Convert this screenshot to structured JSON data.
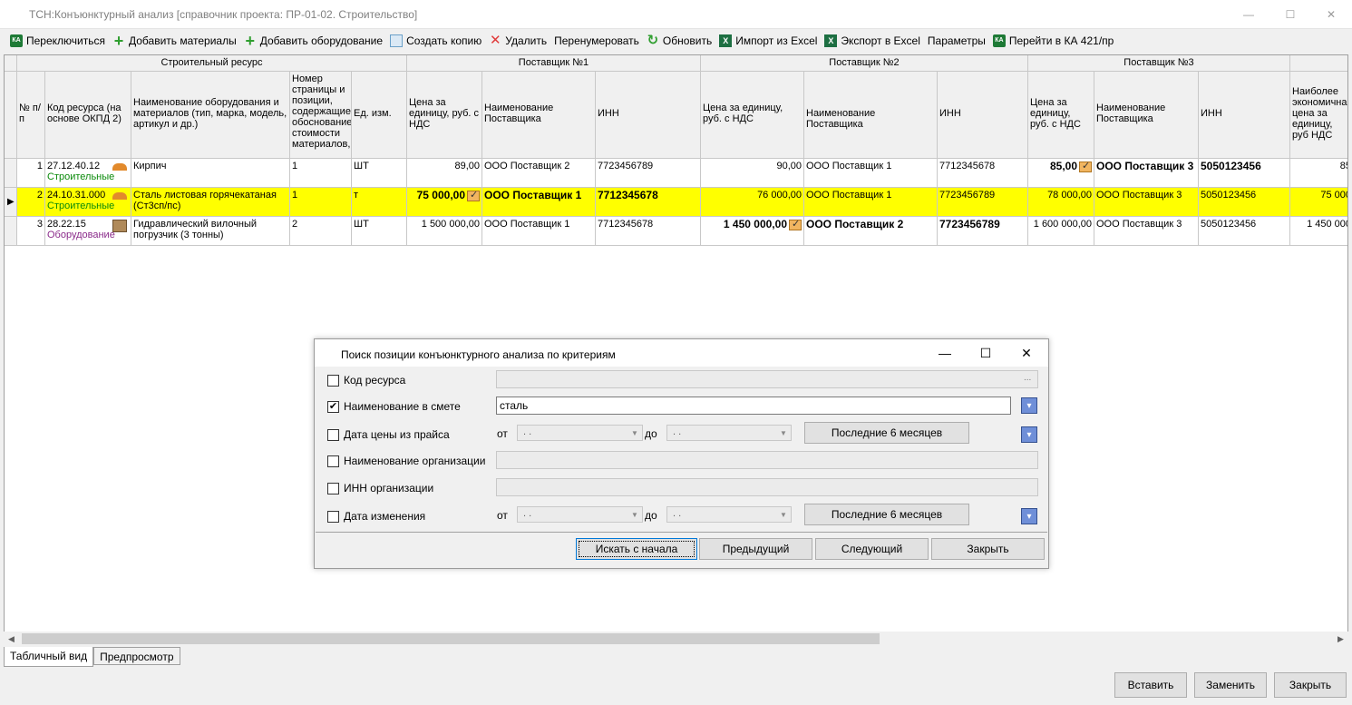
{
  "window": {
    "title": "ТСН:Конъюнктурный анализ [справочник проекта: ПР-01-02. Строительство]"
  },
  "toolbar": {
    "items": [
      {
        "label": "Переключиться",
        "icon": "switch-icon"
      },
      {
        "label": "Добавить материалы",
        "icon": "plus-icon"
      },
      {
        "label": "Добавить оборудование",
        "icon": "plus-icon"
      },
      {
        "label": "Создать копию",
        "icon": "copy-icon"
      },
      {
        "label": "Удалить",
        "icon": "close-icon"
      },
      {
        "label": "Перенумеровать",
        "icon": ""
      },
      {
        "label": "Обновить",
        "icon": "refresh-icon"
      },
      {
        "label": "Импорт из Excel",
        "icon": "excel-icon"
      },
      {
        "label": "Экспорт в Excel",
        "icon": "excel-icon"
      },
      {
        "label": "Параметры",
        "icon": ""
      },
      {
        "label": "Перейти в КА 421/пр",
        "icon": "switch-icon"
      }
    ]
  },
  "grid": {
    "groups": {
      "resource": "Строительный ресурс",
      "supplier1": "Поставщик №1",
      "supplier2": "Поставщик №2",
      "supplier3": "Поставщик №3"
    },
    "headers": {
      "num": "№ п/п",
      "code": "Код ресурса (на основе ОКПД 2)",
      "name": "Наименование оборудования и материалов (тип, марка, модель, артикул и др.)",
      "page": "Номер страницы и позиции, содержащие обоснование стоимости материалов,",
      "unit": "Ед. изм.",
      "price1": "Цена за единицу, руб. с НДС",
      "sname1": "Наименование Поставщика",
      "inn1": "ИНН",
      "price2": "Цена за единицу, руб. с НДС",
      "sname2": "Наименование Поставщика",
      "inn2": "ИНН",
      "price3": "Цена за единицу, руб. с НДС",
      "sname3": "Наименование Поставщика",
      "inn3": "ИНН",
      "best": "Наиболее экономична цена за единицу, руб НДС"
    },
    "rows": [
      {
        "num": "1",
        "code": "27.12.40.12",
        "category": "Строительные",
        "name": "Кирпич",
        "page": "1",
        "unit": "ШТ",
        "price1": "89,00",
        "sname1": "ООО Поставщик 2",
        "inn1": "7723456789",
        "price2": "90,00",
        "sname2": "ООО Поставщик 1",
        "inn2": "7712345678",
        "price3": "85,00",
        "sname3": "ООО Поставщик 3",
        "inn3": "5050123456",
        "best": "85"
      },
      {
        "num": "2",
        "code": "24.10.31.000",
        "category": "Строительные",
        "name": "Сталь листовая горячекатаная (Ст3сп/пс)",
        "page": "1",
        "unit": "т",
        "price1": "75 000,00",
        "sname1": "ООО Поставщик 1",
        "inn1": "7712345678",
        "price2": "76 000,00",
        "sname2": "ООО Поставщик 1",
        "inn2": "7723456789",
        "price3": "78 000,00",
        "sname3": "ООО Поставщик 3",
        "inn3": "5050123456",
        "best": "75 000"
      },
      {
        "num": "3",
        "code": "28.22.15",
        "category": "Оборудование",
        "name": "Гидравлический вилочный погрузчик (3 тонны)",
        "page": "2",
        "unit": "ШТ",
        "price1": "1 500 000,00",
        "sname1": "ООО Поставщик 1",
        "inn1": "7712345678",
        "price2": "1 450 000,00",
        "sname2": "ООО Поставщик 2",
        "inn2": "7723456789",
        "price3": "1 600 000,00",
        "sname3": "ООО Поставщик 3",
        "inn3": "5050123456",
        "best": "1 450 000"
      }
    ]
  },
  "tabs": [
    {
      "label": "Табличный вид",
      "active": true
    },
    {
      "label": "Предпросмотр",
      "active": false
    }
  ],
  "footer": {
    "insert": "Вставить",
    "replace": "Заменить",
    "close": "Закрыть"
  },
  "dialog": {
    "title": "Поиск позиции конъюнктурного анализа по критериям",
    "criteria": {
      "code": {
        "label": "Код ресурса",
        "checked": false,
        "value": "",
        "browse": "..."
      },
      "name": {
        "label": "Наименование в смете",
        "checked": true,
        "value": "сталь"
      },
      "price_date": {
        "label": "Дата цены из прайса",
        "checked": false,
        "from_label": "от",
        "to_label": "до",
        "from": " .  .",
        "to": " .  .",
        "button": "Последние 6 месяцев"
      },
      "org_name": {
        "label": "Наименование организации",
        "checked": false,
        "value": ""
      },
      "org_inn": {
        "label": "ИНН организации",
        "checked": false,
        "value": ""
      },
      "change_date": {
        "label": "Дата изменения",
        "checked": false,
        "from_label": "от",
        "to_label": "до",
        "from": " .  .",
        "to": " .  .",
        "button": "Последние 6 месяцев"
      }
    },
    "buttons": {
      "search_start": "Искать с начала",
      "previous": "Предыдущий",
      "next": "Следующий",
      "close": "Закрыть"
    }
  },
  "colors": {
    "selected_row": "#ffff00",
    "category_green": "#0a8a0a",
    "category_purple": "#8a2a8a"
  }
}
